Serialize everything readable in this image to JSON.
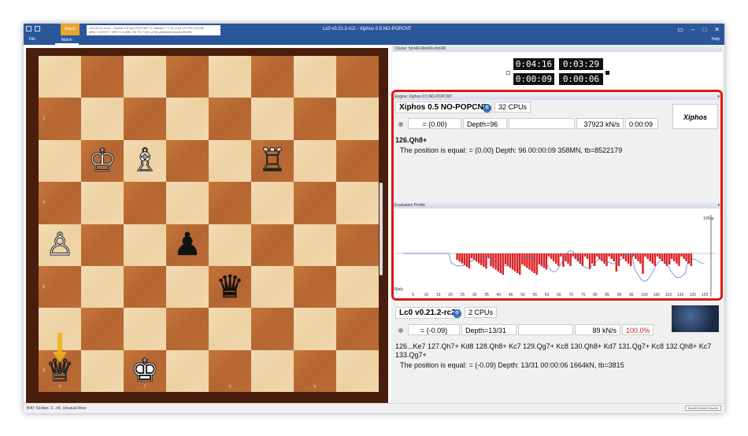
{
  "window": {
    "title": "Lc0 v0.21.2-rc2 - Xiphos 0.5 NO-POPCNT",
    "info_line1": "Lc0 v0.21.2-rc2 - Xiphos 0.5 NO-POPCNT 77 Games: +7 =6 -2 64.7% 7Pr+109.5k",
    "info_line2": "68% +/-47/177, 95% +/-6 (38), 95.7% +/-64 (-4%) predicted moves 55.8%"
  },
  "ribbon": {
    "file": "File",
    "match_top": "Match",
    "match": "Match",
    "help": "Help"
  },
  "board": {
    "ranks": [
      "1",
      "2",
      "3",
      "4",
      "5",
      "6",
      "7",
      "8"
    ],
    "files": [
      "h",
      "g",
      "f",
      "e",
      "d",
      "c",
      "b",
      "a"
    ],
    "squares": [
      [
        "",
        "",
        "",
        "",
        "",
        "",
        "",
        ""
      ],
      [
        "",
        "",
        "",
        "",
        "",
        "",
        "",
        ""
      ],
      [
        "",
        "♔",
        "♗",
        "",
        "",
        "♖",
        "",
        ""
      ],
      [
        "",
        "",
        "",
        "",
        "",
        "",
        "",
        ""
      ],
      [
        "♙",
        "",
        "",
        "♟",
        "",
        "",
        "",
        ""
      ],
      [
        "",
        "",
        "",
        "",
        "♛",
        "",
        "",
        ""
      ],
      [
        "",
        "",
        "",
        "",
        "",
        "",
        "",
        ""
      ],
      [
        "♕",
        "",
        "♚",
        "",
        "",
        "",
        "",
        ""
      ]
    ],
    "piece_colors": [
      [
        "",
        "",
        "",
        "",
        "",
        "",
        "",
        ""
      ],
      [
        "",
        "",
        "",
        "",
        "",
        "",
        "",
        ""
      ],
      [
        "",
        "white",
        "white",
        "",
        "",
        "white",
        "",
        ""
      ],
      [
        "",
        "",
        "",
        "",
        "",
        "",
        "",
        ""
      ],
      [
        "white",
        "",
        "",
        "black",
        "",
        "",
        "",
        ""
      ],
      [
        "",
        "",
        "",
        "",
        "black",
        "",
        "",
        ""
      ],
      [
        "",
        "",
        "",
        "",
        "",
        "",
        "",
        ""
      ],
      [
        "white",
        "",
        "white",
        "",
        "",
        "",
        "",
        ""
      ]
    ]
  },
  "clocks": {
    "header": "Clocks: 5m/40+5m/40+5m/40",
    "time1": "0:04:16",
    "time2": "0:03:29",
    "time3": "0:00:09",
    "time4": "0:00:06"
  },
  "engine1": {
    "header": "Engine: Xiphos 0.5 NO-POPCNT",
    "name": "Xiphos 0.5 NO-POPCNT",
    "cpus": "32 CPUs",
    "eval": "= (0.00)",
    "depth": "Depth=96",
    "speed": "37923 kN/s",
    "time": "0:00:09",
    "move": "126.Qh8+",
    "line": "The position is equal: = (0.00)  Depth: 96   00:00:09  358MN, tb=8522179",
    "logo": "Xiphos"
  },
  "eval_profile": {
    "header": "Evaluation Profile",
    "top_label": "100cp",
    "bottom_label": "96ply",
    "ticks": [
      "5",
      "10",
      "15",
      "20",
      "25",
      "30",
      "35",
      "40",
      "45",
      "50",
      "55",
      "60",
      "65",
      "70",
      "75",
      "80",
      "85",
      "90",
      "95",
      "100",
      "105",
      "110",
      "115",
      "120",
      "125"
    ]
  },
  "engine2": {
    "name": "Lc0 v0.21.2-rc2",
    "cpus": "2 CPUs",
    "eval": "= (-0.09)",
    "depth": "Depth=13/31",
    "speed": "89 kN/s",
    "percent": "100.0%",
    "pv_line1": "126...Ke7 127.Qh7+ Kd8 128.Qh8+ Kc7 129.Qg7+ Kc8 130.Qh8+ Kd7 131.Qg7+ Kc8 132.Qh8+ Kc7",
    "pv_line2": "133.Qg7+",
    "line": "The position is equal: = (-0.09)  Depth: 13/31   00:00:06  1664kN, tb=3815"
  },
  "status": {
    "left": "B40: Sicilian: 2...e6, Unusual lines",
    "right": "5m/40+5m/40+5m/40"
  },
  "colors": {
    "ribbon": "#2b579a",
    "highlight": "#e01818",
    "eval_bar": "#e02020",
    "eval_line": "#5070c0"
  }
}
